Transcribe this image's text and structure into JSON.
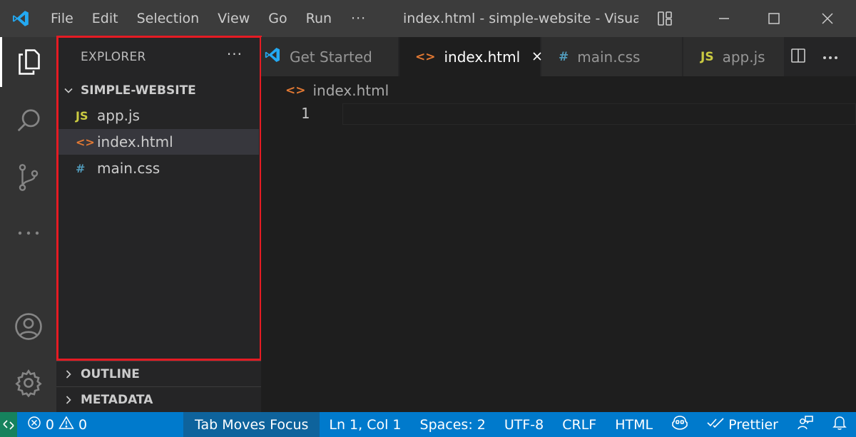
{
  "titlebar": {
    "menu": [
      "File",
      "Edit",
      "Selection",
      "View",
      "Go",
      "Run"
    ],
    "more": "···",
    "window_title": "index.html - simple-website - Visua..."
  },
  "sidebar": {
    "header": "EXPLORER",
    "more": "···",
    "folder": "SIMPLE-WEBSITE",
    "files": [
      {
        "icon": "JS",
        "label": "app.js",
        "color": "#cbcb41"
      },
      {
        "icon": "<>",
        "label": "index.html",
        "color": "#e37933"
      },
      {
        "icon": "#",
        "label": "main.css",
        "color": "#519aba"
      }
    ],
    "sections": [
      "OUTLINE",
      "METADATA"
    ]
  },
  "tabs": [
    {
      "label": "Get Started",
      "icon": "vscode-icon"
    },
    {
      "label": "index.html",
      "icon": "<>",
      "color": "#e37933"
    },
    {
      "label": "main.css",
      "icon": "#",
      "color": "#519aba"
    },
    {
      "label": "app.js",
      "icon": "JS",
      "color": "#cbcb41"
    }
  ],
  "editor": {
    "breadcrumb": "index.html",
    "breadcrumb_icon": "<>",
    "line_number": "1"
  },
  "statusbar": {
    "errors": "0",
    "warnings": "0",
    "tab_focus": "Tab Moves Focus",
    "position": "Ln 1, Col 1",
    "spaces": "Spaces: 2",
    "encoding": "UTF-8",
    "eol": "CRLF",
    "language": "HTML",
    "prettier": "Prettier"
  },
  "colors": {
    "accent": "#007acc",
    "remote": "#16825d",
    "highlight_outline": "#e51b23"
  }
}
